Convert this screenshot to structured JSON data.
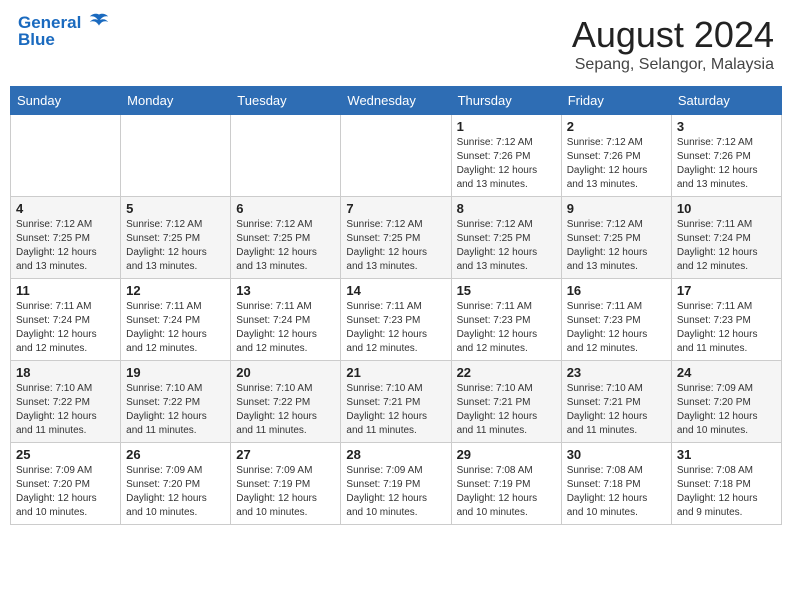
{
  "header": {
    "logo_line1": "General",
    "logo_line2": "Blue",
    "month_year": "August 2024",
    "location": "Sepang, Selangor, Malaysia"
  },
  "days_of_week": [
    "Sunday",
    "Monday",
    "Tuesday",
    "Wednesday",
    "Thursday",
    "Friday",
    "Saturday"
  ],
  "weeks": [
    [
      {
        "day": "",
        "info": ""
      },
      {
        "day": "",
        "info": ""
      },
      {
        "day": "",
        "info": ""
      },
      {
        "day": "",
        "info": ""
      },
      {
        "day": "1",
        "info": "Sunrise: 7:12 AM\nSunset: 7:26 PM\nDaylight: 12 hours\nand 13 minutes."
      },
      {
        "day": "2",
        "info": "Sunrise: 7:12 AM\nSunset: 7:26 PM\nDaylight: 12 hours\nand 13 minutes."
      },
      {
        "day": "3",
        "info": "Sunrise: 7:12 AM\nSunset: 7:26 PM\nDaylight: 12 hours\nand 13 minutes."
      }
    ],
    [
      {
        "day": "4",
        "info": "Sunrise: 7:12 AM\nSunset: 7:25 PM\nDaylight: 12 hours\nand 13 minutes."
      },
      {
        "day": "5",
        "info": "Sunrise: 7:12 AM\nSunset: 7:25 PM\nDaylight: 12 hours\nand 13 minutes."
      },
      {
        "day": "6",
        "info": "Sunrise: 7:12 AM\nSunset: 7:25 PM\nDaylight: 12 hours\nand 13 minutes."
      },
      {
        "day": "7",
        "info": "Sunrise: 7:12 AM\nSunset: 7:25 PM\nDaylight: 12 hours\nand 13 minutes."
      },
      {
        "day": "8",
        "info": "Sunrise: 7:12 AM\nSunset: 7:25 PM\nDaylight: 12 hours\nand 13 minutes."
      },
      {
        "day": "9",
        "info": "Sunrise: 7:12 AM\nSunset: 7:25 PM\nDaylight: 12 hours\nand 13 minutes."
      },
      {
        "day": "10",
        "info": "Sunrise: 7:11 AM\nSunset: 7:24 PM\nDaylight: 12 hours\nand 12 minutes."
      }
    ],
    [
      {
        "day": "11",
        "info": "Sunrise: 7:11 AM\nSunset: 7:24 PM\nDaylight: 12 hours\nand 12 minutes."
      },
      {
        "day": "12",
        "info": "Sunrise: 7:11 AM\nSunset: 7:24 PM\nDaylight: 12 hours\nand 12 minutes."
      },
      {
        "day": "13",
        "info": "Sunrise: 7:11 AM\nSunset: 7:24 PM\nDaylight: 12 hours\nand 12 minutes."
      },
      {
        "day": "14",
        "info": "Sunrise: 7:11 AM\nSunset: 7:23 PM\nDaylight: 12 hours\nand 12 minutes."
      },
      {
        "day": "15",
        "info": "Sunrise: 7:11 AM\nSunset: 7:23 PM\nDaylight: 12 hours\nand 12 minutes."
      },
      {
        "day": "16",
        "info": "Sunrise: 7:11 AM\nSunset: 7:23 PM\nDaylight: 12 hours\nand 12 minutes."
      },
      {
        "day": "17",
        "info": "Sunrise: 7:11 AM\nSunset: 7:23 PM\nDaylight: 12 hours\nand 11 minutes."
      }
    ],
    [
      {
        "day": "18",
        "info": "Sunrise: 7:10 AM\nSunset: 7:22 PM\nDaylight: 12 hours\nand 11 minutes."
      },
      {
        "day": "19",
        "info": "Sunrise: 7:10 AM\nSunset: 7:22 PM\nDaylight: 12 hours\nand 11 minutes."
      },
      {
        "day": "20",
        "info": "Sunrise: 7:10 AM\nSunset: 7:22 PM\nDaylight: 12 hours\nand 11 minutes."
      },
      {
        "day": "21",
        "info": "Sunrise: 7:10 AM\nSunset: 7:21 PM\nDaylight: 12 hours\nand 11 minutes."
      },
      {
        "day": "22",
        "info": "Sunrise: 7:10 AM\nSunset: 7:21 PM\nDaylight: 12 hours\nand 11 minutes."
      },
      {
        "day": "23",
        "info": "Sunrise: 7:10 AM\nSunset: 7:21 PM\nDaylight: 12 hours\nand 11 minutes."
      },
      {
        "day": "24",
        "info": "Sunrise: 7:09 AM\nSunset: 7:20 PM\nDaylight: 12 hours\nand 10 minutes."
      }
    ],
    [
      {
        "day": "25",
        "info": "Sunrise: 7:09 AM\nSunset: 7:20 PM\nDaylight: 12 hours\nand 10 minutes."
      },
      {
        "day": "26",
        "info": "Sunrise: 7:09 AM\nSunset: 7:20 PM\nDaylight: 12 hours\nand 10 minutes."
      },
      {
        "day": "27",
        "info": "Sunrise: 7:09 AM\nSunset: 7:19 PM\nDaylight: 12 hours\nand 10 minutes."
      },
      {
        "day": "28",
        "info": "Sunrise: 7:09 AM\nSunset: 7:19 PM\nDaylight: 12 hours\nand 10 minutes."
      },
      {
        "day": "29",
        "info": "Sunrise: 7:08 AM\nSunset: 7:19 PM\nDaylight: 12 hours\nand 10 minutes."
      },
      {
        "day": "30",
        "info": "Sunrise: 7:08 AM\nSunset: 7:18 PM\nDaylight: 12 hours\nand 10 minutes."
      },
      {
        "day": "31",
        "info": "Sunrise: 7:08 AM\nSunset: 7:18 PM\nDaylight: 12 hours\nand 9 minutes."
      }
    ]
  ]
}
